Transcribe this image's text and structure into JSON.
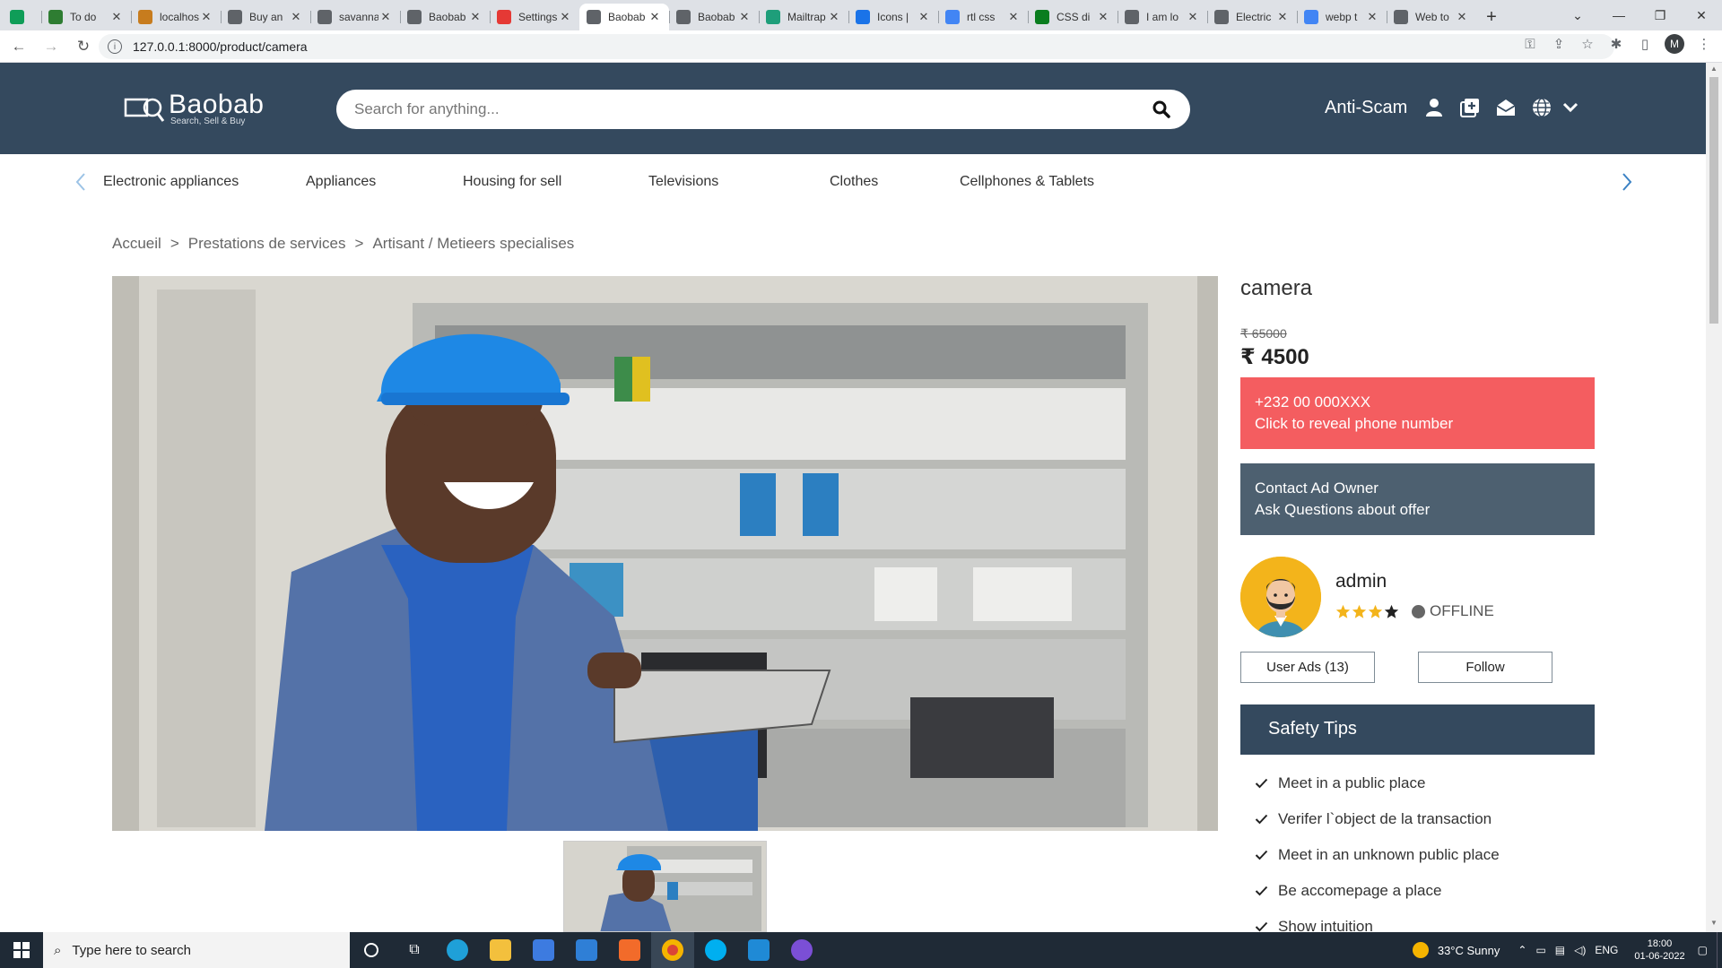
{
  "browser": {
    "tabs": [
      {
        "title": "",
        "color": "#0f9d58",
        "active": false
      },
      {
        "title": "To do",
        "color": "#2e7d32",
        "active": false
      },
      {
        "title": "localhost",
        "color": "#c77c1e",
        "active": false
      },
      {
        "title": "Buy an",
        "color": "#5f6368",
        "active": false
      },
      {
        "title": "savanna",
        "color": "#5f6368",
        "active": false
      },
      {
        "title": "Baobab",
        "color": "#5f6368",
        "active": false
      },
      {
        "title": "Settings",
        "color": "#e53935",
        "active": false
      },
      {
        "title": "Baobab",
        "color": "#5f6368",
        "active": true
      },
      {
        "title": "Baobab",
        "color": "#5f6368",
        "active": false
      },
      {
        "title": "Mailtrap",
        "color": "#1e9e7a",
        "active": false
      },
      {
        "title": "Icons |",
        "color": "#1a73e8",
        "active": false
      },
      {
        "title": "rtl css",
        "color": "#4285f4",
        "active": false
      },
      {
        "title": "CSS di",
        "color": "#0a7d1e",
        "active": false
      },
      {
        "title": "I am lo",
        "color": "#5f6368",
        "active": false
      },
      {
        "title": "Electric",
        "color": "#5f6368",
        "active": false
      },
      {
        "title": "webp t",
        "color": "#4285f4",
        "active": false
      },
      {
        "title": "Web to",
        "color": "#5f6368",
        "active": false
      }
    ],
    "new_tab": "+",
    "url": "127.0.0.1:8000/product/camera",
    "profile_initial": "M"
  },
  "header": {
    "logo_name": "Baobab",
    "logo_tagline": "Search, Sell & Buy",
    "search_placeholder": "Search for anything...",
    "anti_scam": "Anti-Scam"
  },
  "categories": [
    "Electronic appliances",
    "Appliances",
    "Housing for sell",
    "Televisions",
    "Clothes",
    "Cellphones & Tablets"
  ],
  "breadcrumb": [
    "Accueil",
    "Prestations de services",
    "Artisant / Metieers specialises"
  ],
  "breadcrumb_separator": ">",
  "product": {
    "title": "camera",
    "old_price": "₹ 65000",
    "price": "₹ 4500",
    "phone_masked": "+232 00 000XXX",
    "phone_cta": "Click to reveal phone number",
    "contact_title": "Contact Ad Owner",
    "contact_sub": "Ask Questions about offer"
  },
  "owner": {
    "name": "admin",
    "rating": 3,
    "rating_max": 4,
    "status": "OFFLINE",
    "user_ads_label": "User Ads (13)",
    "follow_label": "Follow"
  },
  "safety": {
    "title": "Safety Tips",
    "tips": [
      "Meet in a public place",
      "Verifer l`object de la transaction",
      "Meet in an unknown public place",
      "Be accomepage a place",
      "Show intuition"
    ]
  },
  "colors": {
    "header_bg": "#34495e",
    "phone_bg": "#f45d60",
    "contact_bg": "#4d6070",
    "star": "#f3b41b",
    "category_arrow": "#3b82c4"
  },
  "taskbar": {
    "search_placeholder": "Type here to search",
    "weather": "33°C  Sunny",
    "lang": "ENG",
    "time": "18:00",
    "date": "01-06-2022"
  }
}
